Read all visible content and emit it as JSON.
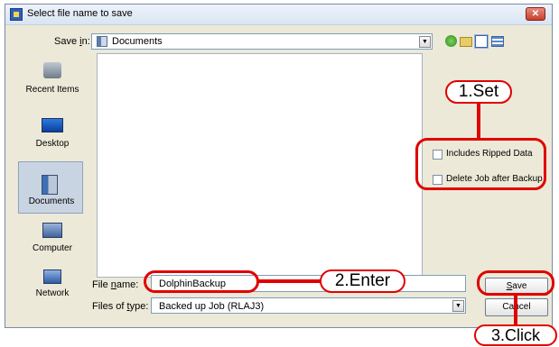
{
  "window": {
    "title": "Select file name to save",
    "close_icon": "close-icon"
  },
  "toolbar": {
    "save_in_prefix": "Save ",
    "save_in_key": "i",
    "save_in_suffix": "n:",
    "save_in_value": "Documents",
    "icons": [
      "back-icon",
      "up-folder-icon",
      "new-folder-icon",
      "view-menu-icon"
    ]
  },
  "places": [
    {
      "label": "Recent Items",
      "icon": "recent-items-icon"
    },
    {
      "label": "Desktop",
      "icon": "desktop-icon"
    },
    {
      "label": "Documents",
      "icon": "documents-icon",
      "selected": true
    },
    {
      "label": "Computer",
      "icon": "computer-icon"
    },
    {
      "label": "Network",
      "icon": "network-icon"
    }
  ],
  "options": {
    "includes_ripped_label": "Includes Ripped Data",
    "includes_ripped_checked": false,
    "delete_after_label": "Delete Job after Backup",
    "delete_after_checked": false
  },
  "file_name": {
    "label_prefix": "File ",
    "label_key": "n",
    "label_suffix": "ame:",
    "value": "DolphinBackup"
  },
  "file_type": {
    "label_prefix": "Files of ",
    "label_key": "t",
    "label_suffix": "ype:",
    "value": "Backed up Job (RLAJ3)"
  },
  "buttons": {
    "save_key": "S",
    "save_rest": "ave",
    "cancel": "Cancel"
  },
  "annotations": {
    "step1": "1.Set",
    "step2": "2.Enter",
    "step3": "3.Click",
    "color": "#e00000"
  }
}
